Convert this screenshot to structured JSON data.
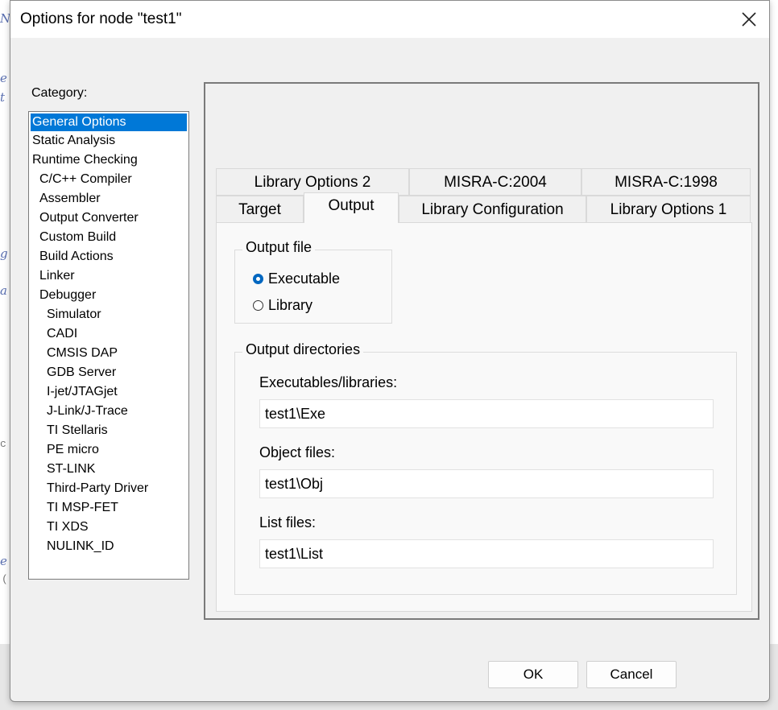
{
  "background": {
    "glyphs": [
      "N",
      "e",
      "t",
      "g",
      "a",
      "c",
      "e",
      "("
    ]
  },
  "dialog": {
    "title": "Options for node \"test1\""
  },
  "category": {
    "label": "Category:",
    "items": [
      {
        "label": "General Options",
        "selected": true
      },
      {
        "label": "Static Analysis"
      },
      {
        "label": "Runtime Checking"
      },
      {
        "label": "C/C++ Compiler"
      },
      {
        "label": "Assembler"
      },
      {
        "label": "Output Converter"
      },
      {
        "label": "Custom Build"
      },
      {
        "label": "Build Actions"
      },
      {
        "label": "Linker"
      },
      {
        "label": "Debugger"
      },
      {
        "label": "Simulator"
      },
      {
        "label": "CADI"
      },
      {
        "label": "CMSIS DAP"
      },
      {
        "label": "GDB Server"
      },
      {
        "label": "I-jet/JTAGjet"
      },
      {
        "label": "J-Link/J-Trace"
      },
      {
        "label": "TI Stellaris"
      },
      {
        "label": "PE micro"
      },
      {
        "label": "ST-LINK"
      },
      {
        "label": "Third-Party Driver"
      },
      {
        "label": "TI MSP-FET"
      },
      {
        "label": "TI XDS"
      },
      {
        "label": "NULINK_ID"
      }
    ]
  },
  "tabs": {
    "row1": [
      "Library Options 2",
      "MISRA-C:2004",
      "MISRA-C:1998"
    ],
    "row2": [
      "Target",
      "Output",
      "Library Configuration",
      "Library Options 1"
    ],
    "active": "Output"
  },
  "output_file": {
    "legend": "Output file",
    "options": [
      {
        "label": "Executable",
        "checked": true
      },
      {
        "label": "Library",
        "checked": false
      }
    ]
  },
  "output_directories": {
    "legend": "Output directories",
    "executables_label": "Executables/libraries:",
    "executables_value": "test1\\Exe",
    "object_label": "Object files:",
    "object_value": "test1\\Obj",
    "list_label": "List files:",
    "list_value": "test1\\List"
  },
  "buttons": {
    "ok": "OK",
    "cancel": "Cancel"
  }
}
